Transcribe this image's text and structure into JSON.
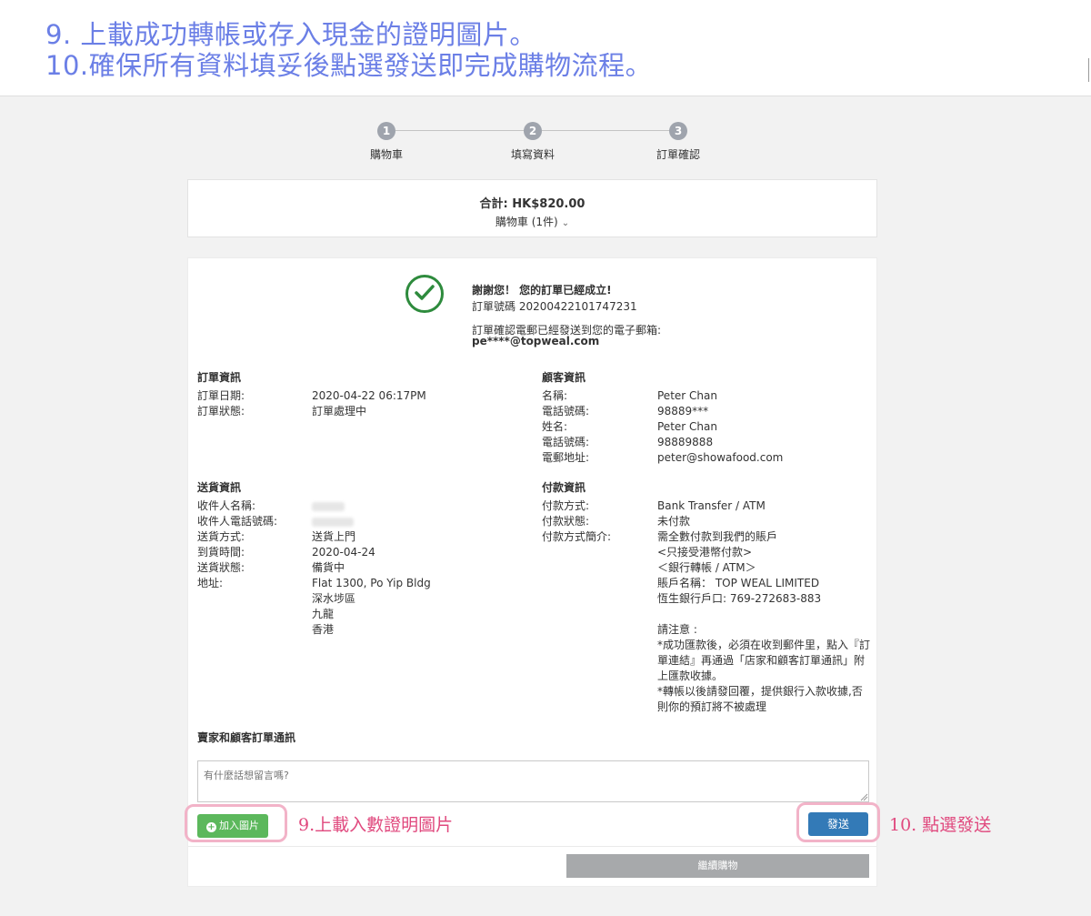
{
  "banner": {
    "line1": "9. 上載成功轉帳或存入現金的證明圖片。",
    "line2": "10.確保所有資料填妥後點選發送即完成購物流程。"
  },
  "steps": [
    {
      "num": "1",
      "label": "購物車"
    },
    {
      "num": "2",
      "label": "填寫資料"
    },
    {
      "num": "3",
      "label": "訂單確認"
    }
  ],
  "summary": {
    "total": "合計: HK$820.00",
    "cart": "購物車 (1件)"
  },
  "confirmation": {
    "thanks": "謝謝您！ 您的訂單已經成立!",
    "order_no": "訂單號碼 20200422101747231",
    "email_note": "訂單確認電郵已經發送到您的電子郵箱:",
    "email": "pe****@topweal.com"
  },
  "order_info": {
    "title": "訂單資訊",
    "rows": [
      {
        "label": "訂單日期:",
        "value": "2020-04-22 06:17PM"
      },
      {
        "label": "訂單狀態:",
        "value": "訂單處理中"
      }
    ]
  },
  "customer_info": {
    "title": "顧客資訊",
    "rows": [
      {
        "label": "名稱:",
        "value": "Peter Chan"
      },
      {
        "label": "電話號碼:",
        "value": "98889***"
      },
      {
        "label": "姓名:",
        "value": "Peter Chan"
      },
      {
        "label": "電話號碼:",
        "value": "98889888"
      },
      {
        "label": "電郵地址:",
        "value": "peter@showafood.com"
      }
    ]
  },
  "delivery_info": {
    "title": "送貨資訊",
    "rows": [
      {
        "label": "收件人名稱:",
        "value": ""
      },
      {
        "label": "收件人電話號碼:",
        "value": ""
      },
      {
        "label": "送貨方式:",
        "value": "送貨上門"
      },
      {
        "label": "到貨時間:",
        "value": "2020-04-24"
      },
      {
        "label": "送貨狀態:",
        "value": "備貨中"
      },
      {
        "label": "地址:",
        "value": "Flat 1300, Po Yip Bldg"
      }
    ],
    "address_lines": [
      "深水埗區",
      "九龍",
      "香港"
    ]
  },
  "payment_info": {
    "title": "付款資訊",
    "rows": [
      {
        "label": "付款方式:",
        "value": "Bank Transfer / ATM"
      },
      {
        "label": "付款狀態:",
        "value": "未付款"
      },
      {
        "label": "付款方式簡介:",
        "value": "需全數付款到我們的賬戶"
      }
    ],
    "desc_lines": [
      "<只接受港幣付款>",
      "＜銀行轉帳 / ATM＞",
      "賬戶名稱：  TOP WEAL LIMITED",
      "恆生銀行戶口: 769-272683-883",
      "",
      "請注意 :",
      "*成功匯款後，必須在收到郵件里，點入『訂",
      "單連結』再通過「店家和顧客訂單通訊」附",
      "上匯款收據。",
      "*轉帳以後請發回覆，提供銀行入款收據,否",
      "則你的預訂將不被處理"
    ]
  },
  "communication": {
    "title": "賣家和顧客訂單通訊",
    "placeholder": "有什麼話想留言嗎?",
    "add_image_label": "加入圖片",
    "send_label": "發送",
    "continue_label": "繼續購物"
  },
  "annotations": {
    "upload_note": "9.上載入數證明圖片",
    "send_note": "10. 點選發送"
  },
  "colors": {
    "banner_text": "#6b7fe6",
    "check": "#2e8b3d",
    "add_button": "#5cb85c",
    "send_button": "#337ab7",
    "continue_button": "#a7a9ab",
    "highlight": "#f2b3c8",
    "annotation": "#e0497e"
  }
}
